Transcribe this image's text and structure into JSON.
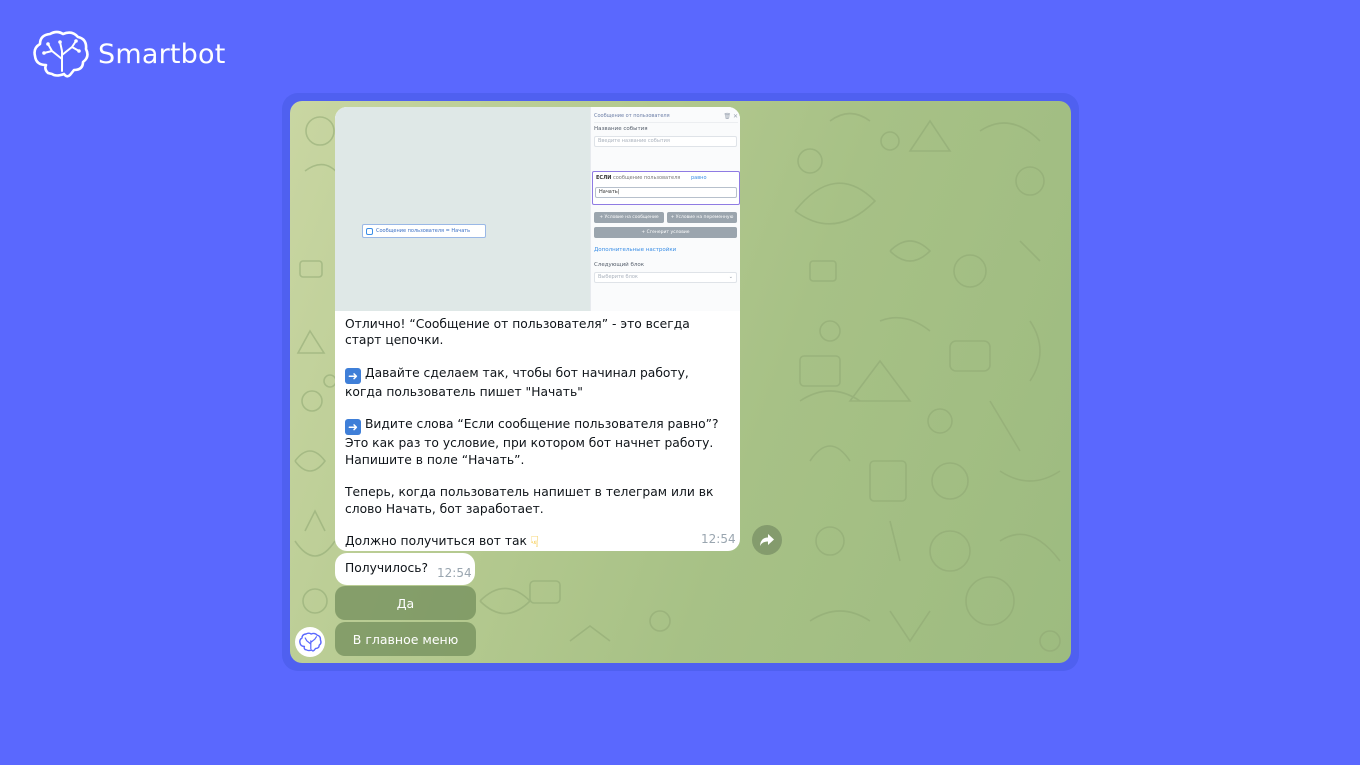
{
  "brand": {
    "name": "Smartbot",
    "logo_icon": "brain-tree-icon"
  },
  "colors": {
    "background": "#5a68fe",
    "frame": "#4f60f0",
    "chat_bg": "#b4c98f",
    "bubble": "#ffffff",
    "keyboard_button": "#708c5a"
  },
  "message": {
    "screenshot": {
      "node_label": "Сообщение пользователя = Начать",
      "panel_title": "Сообщение от пользователя",
      "event_name_label": "Название события",
      "event_name_placeholder": "Введите название события",
      "if_label": "ЕСЛИ",
      "condition_field": "сообщение пользователя",
      "condition_operator": "равно",
      "condition_value": "Начать|",
      "btn_message_condition": "+ Условие на сообщение",
      "btn_variable_condition": "+ Условие на переменную",
      "btn_group_condition": "+ Сгенерит условие",
      "extra_settings": "Дополнительные настройки",
      "next_block_label": "Следующий блок",
      "next_block_placeholder": "Выберите блок"
    },
    "paragraphs": {
      "p1": "Отлично! “Сообщение от пользователя” - это всегда старт цепочки.",
      "p2": "Давайте сделаем так, чтобы бот начинал работу, когда пользователь пишет \"Начать\"",
      "p3": "Видите слова “Если сообщение пользователя равно”? Это как раз то условие, при котором бот начнет работу. Напишите в поле “Начать”.",
      "p4": "Теперь, когда пользователь напишет в телеграм или вк слово Начать, бот заработает.",
      "p5": "Должно получиться вот так"
    },
    "time": "12:54"
  },
  "message2": {
    "text": "Получилось?",
    "time": "12:54"
  },
  "keyboard": {
    "yes": "Да",
    "main_menu": "В главное меню"
  }
}
